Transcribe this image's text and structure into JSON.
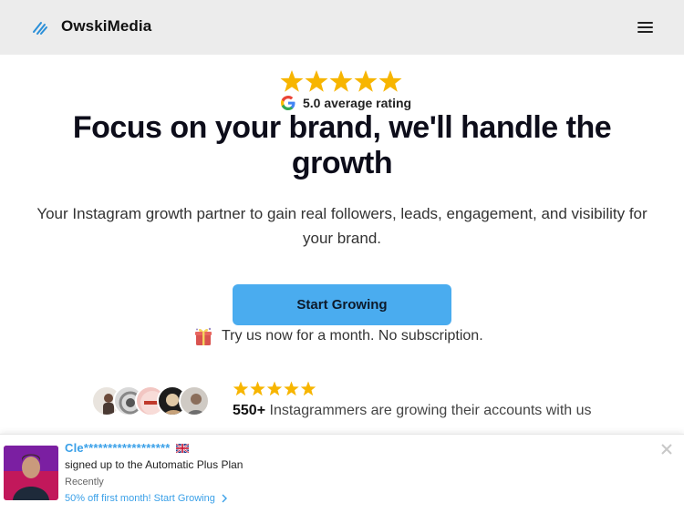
{
  "header": {
    "brand": "OwskiMedia",
    "logo_icon": "slanted-lines-logo-icon",
    "menu_icon": "hamburger-menu-icon"
  },
  "rating": {
    "stars": 5,
    "text": "5.0 average rating",
    "provider_icon": "google-g-icon"
  },
  "hero": {
    "headline": "Focus on your brand, we'll handle the growth",
    "subtitle": "Your Instagram growth partner to gain real followers, leads, engagement, and visibility for your brand."
  },
  "cta": {
    "label": "Start Growing"
  },
  "trial": {
    "icon": "gift-icon",
    "text": "Try us now for a month. No subscription."
  },
  "social_proof": {
    "stars": 5,
    "count": "550+",
    "text": "Instagrammers are growing their accounts with us",
    "avatars": [
      "avatar-1",
      "avatar-2",
      "avatar-3",
      "avatar-4",
      "avatar-5"
    ]
  },
  "popup": {
    "name": "Cle******************",
    "flag_icon": "uk-flag-icon",
    "action": "signed up to the Automatic Plus Plan",
    "time": "Recently",
    "link": "50% off first month! Start Growing",
    "close_icon": "close-icon"
  },
  "colors": {
    "accent": "#4aacef",
    "star": "#f7b500",
    "header_bg": "#ececec",
    "link": "#3aa0e8"
  }
}
